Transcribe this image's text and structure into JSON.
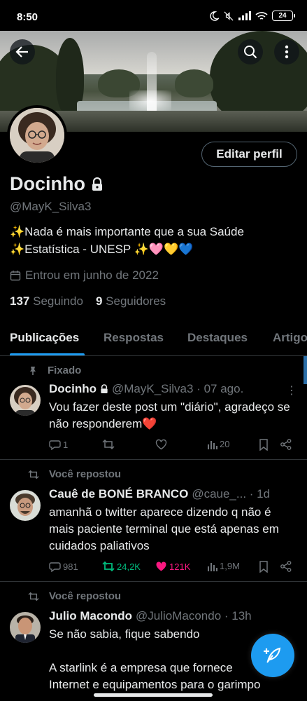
{
  "status_bar": {
    "time": "8:50",
    "battery": "24"
  },
  "profile": {
    "name": "Docinho",
    "handle": "@MayK_Silva3",
    "bio_line1": "✨Nada é mais importante que a sua Saúde",
    "bio_line2": "✨Estatística - UNESP  ✨🩷💛💙",
    "joined": "Entrou em junho de 2022",
    "following_count": "137",
    "following_label": "Seguindo",
    "followers_count": "9",
    "followers_label": "Seguidores",
    "edit_label": "Editar perfil"
  },
  "tabs": [
    "Publicações",
    "Respostas",
    "Destaques",
    "Artigos"
  ],
  "tweets": [
    {
      "context": "Fixado",
      "name": "Docinho",
      "meta": "@MayK_Silva3 · 07 ago.",
      "text": "Vou fazer deste post um \"diário\", agradeço se não responderem❤️",
      "replies": "1",
      "retweets": "",
      "likes": "",
      "views": "20"
    },
    {
      "context": "Você repostou",
      "name": "Cauê de BONÉ BRANCO",
      "meta": "@caue_... · 1d",
      "text": "amanhã o twitter aparece dizendo q não é mais paciente terminal que está apenas em cuidados paliativos",
      "replies": "981",
      "retweets": "24,2K",
      "likes": "121K",
      "views": "1,9M"
    },
    {
      "context": "Você repostou",
      "name": "Julio Macondo",
      "meta": "@JulioMacondo · 13h",
      "text": "Se não sabia, fique sabendo\n\nA starlink é a empresa que fornece\nInternet e equipamentos para o garimpo",
      "replies": "",
      "retweets": "",
      "likes": "",
      "views": ""
    }
  ],
  "colors": {
    "accent": "#1d9bf0",
    "retweet_green": "#00ba7c",
    "like_pink": "#f91880",
    "muted": "#71767b"
  }
}
